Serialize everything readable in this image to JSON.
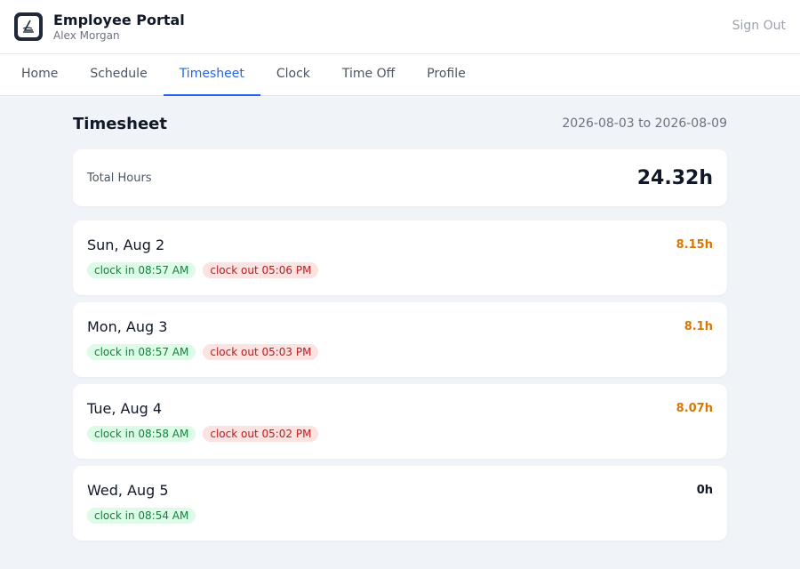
{
  "header": {
    "title": "Employee Portal",
    "user": "Alex Morgan",
    "sign_out": "Sign Out"
  },
  "nav": {
    "tabs": [
      {
        "label": "Home",
        "active": false
      },
      {
        "label": "Schedule",
        "active": false
      },
      {
        "label": "Timesheet",
        "active": true
      },
      {
        "label": "Clock",
        "active": false
      },
      {
        "label": "Time Off",
        "active": false
      },
      {
        "label": "Profile",
        "active": false
      }
    ]
  },
  "timesheet": {
    "title": "Timesheet",
    "range": "2026-08-03 to 2026-08-09",
    "total_label": "Total Hours",
    "total_value": "24.32h",
    "days": [
      {
        "date": "Sun, Aug 2",
        "hours": "8.15h",
        "clock_in": "clock in 08:57 AM",
        "clock_out": "clock out 05:06 PM"
      },
      {
        "date": "Mon, Aug 3",
        "hours": "8.1h",
        "clock_in": "clock in 08:57 AM",
        "clock_out": "clock out 05:03 PM"
      },
      {
        "date": "Tue, Aug 4",
        "hours": "8.07h",
        "clock_in": "clock in 08:58 AM",
        "clock_out": "clock out 05:02 PM"
      },
      {
        "date": "Wed, Aug 5",
        "hours": "0h",
        "clock_in": "clock in 08:54 AM",
        "clock_out": ""
      }
    ]
  },
  "colors": {
    "accent": "#2563eb",
    "hours_positive": "#d97706",
    "hours_zero": "#111827",
    "clock_in_bg": "#dcfce7",
    "clock_out_bg": "#fde2e2"
  }
}
